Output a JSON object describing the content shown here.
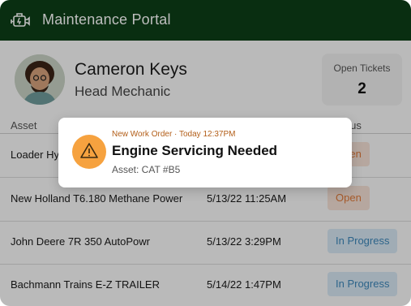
{
  "app": {
    "title": "Maintenance Portal"
  },
  "user": {
    "name": "Cameron Keys",
    "role": "Head Mechanic"
  },
  "tickets": {
    "label": "Open Tickets",
    "count": "2"
  },
  "table": {
    "headers": {
      "asset": "Asset",
      "status": "Status"
    },
    "rows": [
      {
        "asset": "Loader Hy",
        "date": "",
        "status": "Open"
      },
      {
        "asset": "New Holland T6.180 Methane Power",
        "date": "5/13/22 11:25AM",
        "status": "Open"
      },
      {
        "asset": "John Deere 7R 350 AutoPowr",
        "date": "5/13/22 3:29PM",
        "status": "In Progress"
      },
      {
        "asset": "Bachmann Trains E-Z TRAILER",
        "date": "5/14/22 1:47PM",
        "status": "In Progress"
      }
    ]
  },
  "notification": {
    "kicker": "New Work Order · Today 12:37PM",
    "title": "Engine Servicing Needed",
    "subtitle": "Asset: CAT #B5",
    "icon": "warning-icon"
  },
  "colors": {
    "header_bg": "#0d3f18",
    "open_badge": "#e07a3a",
    "progress_badge": "#3d87bb",
    "warning": "#f6a23f"
  }
}
